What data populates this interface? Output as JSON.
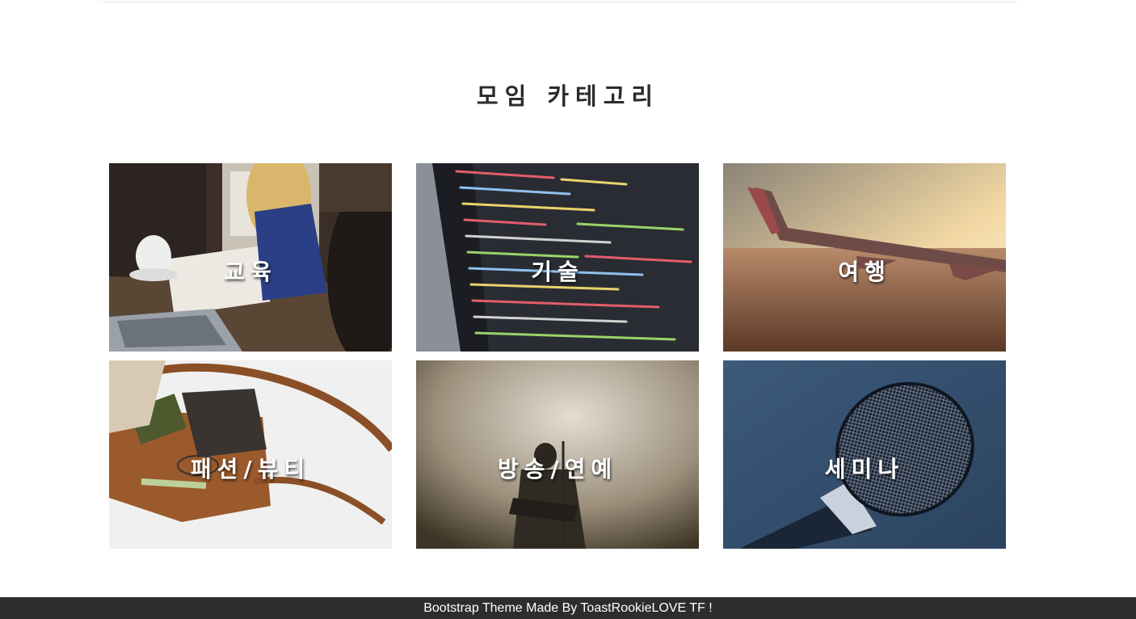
{
  "section": {
    "title": "모임 카테고리"
  },
  "categories": [
    {
      "label": "교육",
      "image": "study-meeting-photo"
    },
    {
      "label": "기술",
      "image": "code-screen-photo"
    },
    {
      "label": "여행",
      "image": "airplane-wing-photo"
    },
    {
      "label": "패션/뷰티",
      "image": "leather-bag-photo"
    },
    {
      "label": "방송/연예",
      "image": "stage-performer-photo"
    },
    {
      "label": "세미나",
      "image": "microphone-photo"
    }
  ],
  "footer": {
    "text": "Bootstrap Theme Made By ToastRookieLOVE TF !"
  },
  "colors": {
    "footer_bg": "#2d2d2d",
    "title": "#2b2b2b",
    "label": "#ffffff"
  }
}
